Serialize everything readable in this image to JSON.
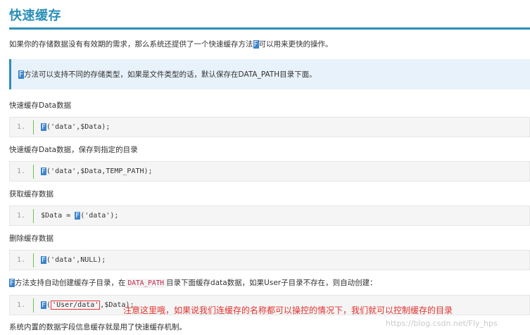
{
  "title": "快速缓存",
  "intro": {
    "before": "如果你的存储数据没有有效期的需求，那么系统还提供了一个快速缓存方法",
    "fn": "F",
    "after": "可以用来更快的操作。"
  },
  "note": {
    "fn": "F",
    "text": "方法可以支持不同的存储类型，如果是文件类型的话，默认保存在DATA_PATH目录下面。"
  },
  "sections": [
    {
      "heading": "快速缓存Data数据",
      "line_no": "1.",
      "code_fn": "F",
      "code_rest": "('data',$Data);"
    },
    {
      "heading": "快速缓存Data数据，保存到指定的目录",
      "line_no": "1.",
      "code_fn": "F",
      "code_rest": "('data',$Data,TEMP_PATH);"
    },
    {
      "heading": "获取缓存数据",
      "line_no": "1.",
      "code_pre": "$Data = ",
      "code_fn": "F",
      "code_rest": "('data');"
    },
    {
      "heading": "删除缓存数据",
      "line_no": "1.",
      "code_fn": "F",
      "code_rest": "('data',NULL);"
    }
  ],
  "dir_para": {
    "fn": "F",
    "text1": "方法支持自动创建缓存子目录，在",
    "code": "DATA_PATH",
    "text2": "目录下面缓存data数据，如果User子目录不存在，则自动创建："
  },
  "last_code": {
    "line_no": "1.",
    "fn": "F",
    "open": "(",
    "arg": "'User/data'",
    "close": ",$Data);"
  },
  "annotation": "注意这里哦，如果说我们连缓存的名称都可以操控的情况下，我们就可以控制缓存的目录",
  "footer": "系统内置的数据字段信息缓存就是用了快速缓存机制。",
  "watermark": "https://blog.csdn.net/Fly_hps"
}
